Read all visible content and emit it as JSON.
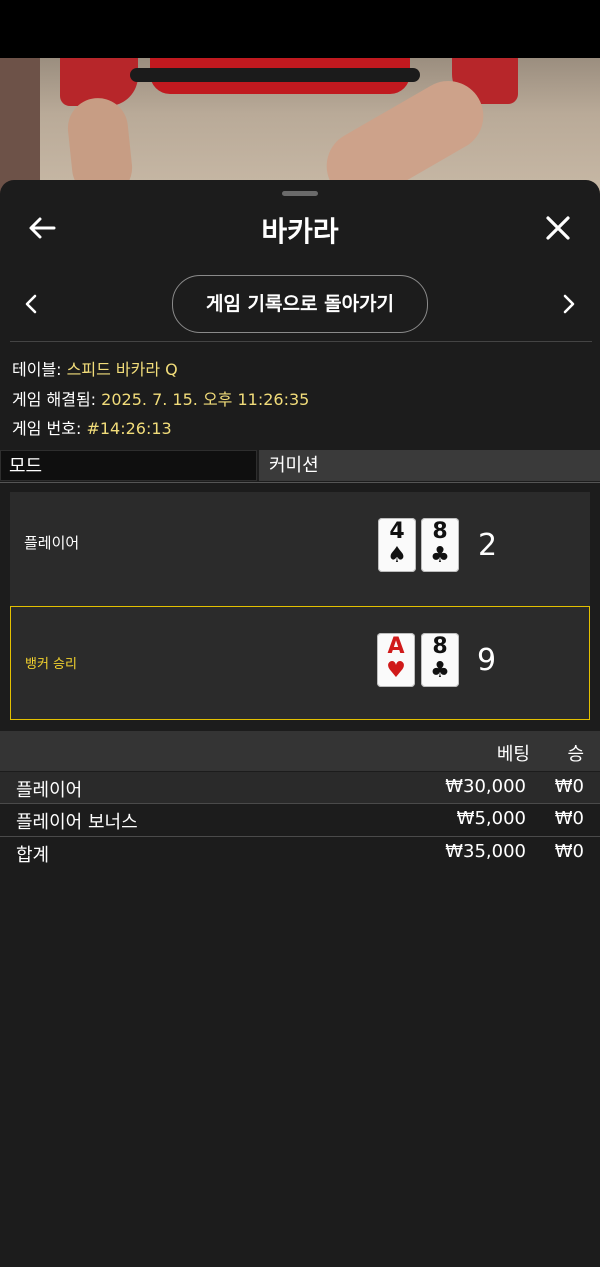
{
  "header": {
    "title": "바카라",
    "back_button_label": "게임 기록으로 돌아가기"
  },
  "game_info": {
    "table_label": "테이블:",
    "table_value": "스피드 바카라 Q",
    "resolved_label": "게임 해결됨:",
    "resolved_value": "2025. 7. 15. 오후 11:26:35",
    "game_number_label": "게임 번호:",
    "game_number_value": "#14:26:13"
  },
  "mode": {
    "label": "모드",
    "value": "커미션"
  },
  "hands": {
    "player": {
      "label": "플레이어",
      "cards": [
        {
          "rank": "4",
          "suit": "♠",
          "color": "#111111"
        },
        {
          "rank": "8",
          "suit": "♣",
          "color": "#111111"
        }
      ],
      "score": "2"
    },
    "banker": {
      "label": "뱅커 승리",
      "cards": [
        {
          "rank": "A",
          "suit": "♥",
          "color": "#d01a1a"
        },
        {
          "rank": "8",
          "suit": "♣",
          "color": "#111111"
        }
      ],
      "score": "9",
      "winner_color": "#e3c000"
    }
  },
  "bets": {
    "headers": {
      "bet": "베팅",
      "win": "승"
    },
    "rows": [
      {
        "name": "플레이어",
        "amount": "₩30,000",
        "win": "₩0"
      },
      {
        "name": "플레이어 보너스",
        "amount": "₩5,000",
        "win": "₩0"
      },
      {
        "name": "합계",
        "amount": "₩35,000",
        "win": "₩0"
      }
    ]
  },
  "colors": {
    "accent_yellow": "#f1dc7a",
    "winner_border": "#e3c000",
    "sheet_bg": "#1c1c1c"
  }
}
